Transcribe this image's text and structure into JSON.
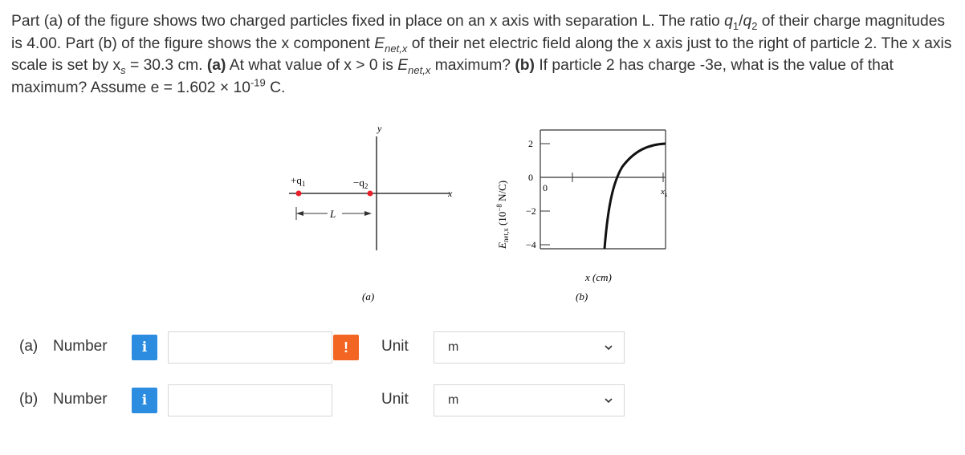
{
  "question": {
    "p1": "Part (a) of the figure shows two charged particles fixed in place on an x axis with separation L. The ratio ",
    "q1": "q",
    "q1_sub": "1",
    "slash": "/",
    "q2": "q",
    "q2_sub": "2",
    "p2": " of their charge magnitudes is 4.00. Part (b) of the figure shows the x component ",
    "E": "E",
    "E_sub": "net,x",
    "p3": " of their net electric field along the x axis just to the right of particle 2. The x axis scale is set by x",
    "xs_sub": "s",
    "p4": " = 30.3 cm. ",
    "a_bold": "(a)",
    "p5": " At what value of x > 0 is ",
    "E2": "E",
    "E2_sub": "net,x",
    "p6": " maximum? ",
    "b_bold": "(b)",
    "p7": " If particle 2 has charge -3e, what is the value of that maximum? Assume e = 1.602 × 10",
    "exp": "-19",
    "p8": " C."
  },
  "figure_a": {
    "q1_label": "+q",
    "q1_sub": "1",
    "q2_label": "−q",
    "q2_sub": "2",
    "y_label": "y",
    "x_label": "x",
    "L_label": "L",
    "caption": "(a)",
    "charge_color": "#e8202a"
  },
  "figure_b": {
    "y_axis_label": "E",
    "y_axis_sub": "net,x",
    "y_axis_unit": " (10",
    "y_axis_exp": "−8",
    "y_axis_unit2": " N/C)",
    "y_ticks": [
      "2",
      "0",
      "−2",
      "−4"
    ],
    "origin_label": "0",
    "xs_label": "x",
    "xs_sub": "s",
    "x_axis_label": "x (cm)",
    "caption": "(b)"
  },
  "answers": [
    {
      "part": "(a)",
      "label": "Number",
      "info": "i",
      "value": "",
      "warning": "!",
      "unit_label": "Unit",
      "unit": "m"
    },
    {
      "part": "(b)",
      "label": "Number",
      "info": "i",
      "value": "",
      "unit_label": "Unit",
      "unit": "m"
    }
  ]
}
